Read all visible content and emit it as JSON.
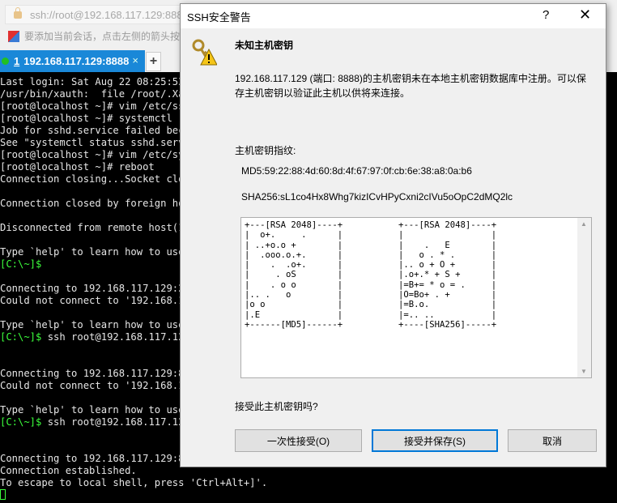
{
  "browser": {
    "address": "ssh://root@192.168.117.129:888",
    "message": "要添加当前会话，点击左侧的箭头按"
  },
  "tab": {
    "number": "1",
    "label": "192.168.117.129:8888",
    "close": "×",
    "add": "+"
  },
  "terminal": {
    "lines": [
      [
        "Last login: Sat Aug 22 08:25:53",
        ""
      ],
      [
        "/usr/bin/xauth:  file /root/.Xau",
        ""
      ],
      [
        "[root@localhost ~]# vim /etc/ssh",
        ""
      ],
      [
        "[root@localhost ~]# systemctl re",
        ""
      ],
      [
        "Job for sshd.service failed beca",
        ""
      ],
      [
        "See \"systemctl status sshd.servi",
        ""
      ],
      [
        "[root@localhost ~]# vim /etc/sys",
        ""
      ],
      [
        "[root@localhost ~]# reboot",
        ""
      ],
      [
        "Connection closing...Socket clos",
        ""
      ],
      [
        "",
        ""
      ],
      [
        "Connection closed by foreign hos",
        ""
      ],
      [
        "",
        ""
      ],
      [
        "Disconnected from remote host(19",
        ""
      ],
      [
        "",
        ""
      ],
      [
        "Type `help' to learn how to use",
        ""
      ],
      [
        "",
        "[C:\\~]$"
      ],
      [
        "",
        ""
      ],
      [
        "Connecting to 192.168.117.129:22",
        ""
      ],
      [
        "Could not connect to '192.168.11",
        ""
      ],
      [
        "",
        ""
      ],
      [
        "Type `help' to learn how to use",
        ""
      ],
      [
        " ssh root@192.168.117.129",
        "[C:\\~]$"
      ],
      [
        "",
        ""
      ],
      [
        "",
        ""
      ],
      [
        "Connecting to 192.168.117.129:88",
        ""
      ],
      [
        "Could not connect to '192.168.11",
        ""
      ],
      [
        "",
        ""
      ],
      [
        "Type `help' to learn how to use",
        ""
      ],
      [
        " ssh root@192.168.117.129",
        "[C:\\~]$"
      ],
      [
        "",
        ""
      ],
      [
        "",
        ""
      ],
      [
        "Connecting to 192.168.117.129:88",
        ""
      ],
      [
        "Connection established.",
        ""
      ],
      [
        "To escape to local shell, press 'Ctrl+Alt+]'.",
        ""
      ]
    ]
  },
  "dialog": {
    "title": "SSH安全警告",
    "help": "?",
    "close": "✕",
    "heading": "未知主机密钥",
    "desc1": "192.168.117.129 (端口: 8888)的主机密钥未在本地主机密钥数据库中注册。可以保",
    "desc2": "存主机密钥以验证此主机以供将来连接。",
    "fp_label": "主机密钥指纹:",
    "md5": "MD5:59:22:88:4d:60:8d:4f:67:97:0f:cb:6e:38:a8:0a:b6",
    "sha256": "SHA256:sL1co4Hx8Whg7kizICvHPyCxni2cIVu5oOpC2dMQ2lc",
    "art_md5": "+---[RSA 2048]----+\n|  o+.     .      |\n| ..+o.o +        |\n|  .ooo.o.+.      |\n|    .  .o+.      |\n|     . oS        |\n|    . o o        |\n|.. .   o         |\n|o o              |\n|.E               |\n+------[MD5]------+",
    "art_sha": "+---[RSA 2048]----+\n|                 |\n|    .   E        |\n|   o . * .       |\n|.. o + O +       |\n|.o+.* + S +      |\n|=B+= * o = .     |\n|O=Bo+ . +        |\n|=B.o.            |\n|=.. ..           |\n+----[SHA256]-----+",
    "question": "接受此主机密钥吗?",
    "buttons": {
      "once": "一次性接受(O)",
      "save": "接受并保存(S)",
      "cancel": "取消"
    }
  }
}
